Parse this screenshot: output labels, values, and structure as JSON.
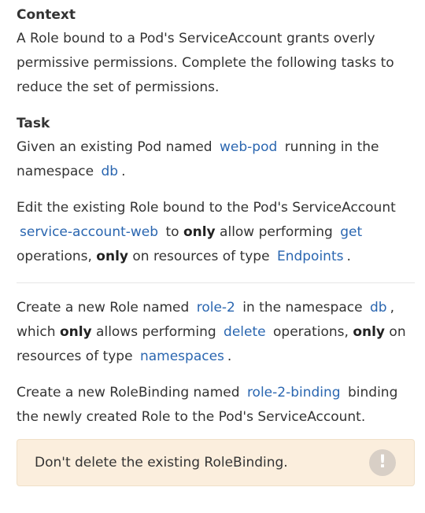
{
  "context": {
    "heading": "Context",
    "text": "A Role bound to a Pod's ServiceAccount grants overly permissive permissions. Complete the following tasks to reduce the set of permissions."
  },
  "task": {
    "heading": "Task",
    "p1": {
      "t1": "Given an existing Pod named",
      "pod": "web-pod",
      "t2": "running in the namespace",
      "ns": "db",
      "t3": "."
    },
    "p2": {
      "t1": "Edit the existing Role bound to the Pod's ServiceAccount",
      "sa": "service-account-web",
      "t2": "to",
      "only1": "only",
      "t3": "allow performing",
      "verb": "get",
      "t4": "operations,",
      "only2": "only",
      "t5": "on resources of type",
      "res": "Endpoints",
      "t6": "."
    },
    "p3": {
      "t1": "Create a new Role named",
      "role": "role-2",
      "t2": "in the namespace",
      "ns": "db",
      "t3": ", which",
      "only1": "only",
      "t4": "allows performing",
      "verb": "delete",
      "t5": "operations,",
      "only2": "only",
      "t6": "on resources of type",
      "res": "namespaces",
      "t7": "."
    },
    "p4": {
      "t1": "Create a new RoleBinding named",
      "rb": "role-2-binding",
      "t2": "binding the newly created Role to the Pod's ServiceAccount."
    }
  },
  "note": {
    "text": "Don't delete the existing RoleBinding.",
    "icon": "!"
  },
  "colors": {
    "code": "#2a66b0",
    "note_bg": "#fbeedd",
    "icon_bg": "#d8cfc6"
  }
}
